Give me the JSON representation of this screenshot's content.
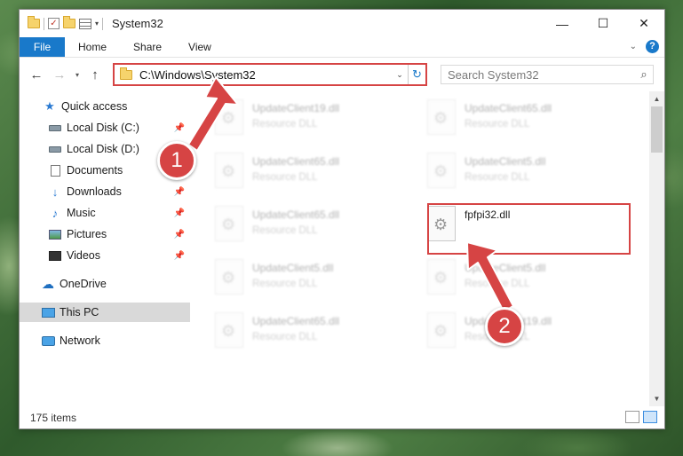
{
  "window": {
    "title": "System32",
    "controls": {
      "minimize": "—",
      "maximize": "☐",
      "close": "✕"
    }
  },
  "ribbon": {
    "tabs": [
      "File",
      "Home",
      "Share",
      "View"
    ]
  },
  "navigation": {
    "back": "←",
    "forward": "→",
    "recent": "▾",
    "up": "↑",
    "address": "C:\\Windows\\System32",
    "search_placeholder": "Search System32"
  },
  "sidebar": {
    "items": [
      {
        "label": "Quick access",
        "icon": "quick-access-star-icon"
      },
      {
        "label": "Local Disk (C:)",
        "icon": "drive-icon",
        "pinned": true
      },
      {
        "label": "Local Disk (D:)",
        "icon": "drive-icon",
        "pinned": false
      },
      {
        "label": "Documents",
        "icon": "documents-icon",
        "pinned": true
      },
      {
        "label": "Downloads",
        "icon": "downloads-icon",
        "pinned": true
      },
      {
        "label": "Music",
        "icon": "music-icon",
        "pinned": true
      },
      {
        "label": "Pictures",
        "icon": "pictures-icon",
        "pinned": true
      },
      {
        "label": "Videos",
        "icon": "videos-icon",
        "pinned": true
      },
      {
        "label": "OneDrive",
        "icon": "onedrive-icon"
      },
      {
        "label": "This PC",
        "icon": "this-pc-icon",
        "selected": true
      },
      {
        "label": "Network",
        "icon": "network-icon"
      }
    ]
  },
  "files": [
    {
      "name": "UpdateClient19.dll",
      "type": "Resource DLL"
    },
    {
      "name": "UpdateClient65.dll",
      "type": "Resource DLL"
    },
    {
      "name": "UpdateClient65.dll",
      "type": "Resource DLL"
    },
    {
      "name": "UpdateClient5.dll",
      "type": "Resource DLL"
    },
    {
      "name": "UpdateClient65.dll",
      "type": "Resource DLL"
    },
    {
      "name": "fpfpi32.dll",
      "type": ""
    },
    {
      "name": "UpdateClient5.dll",
      "type": "Resource DLL"
    },
    {
      "name": "UpdateClient5.dll",
      "type": "Resource DLL"
    },
    {
      "name": "UpdateClient65.dll",
      "type": "Resource DLL"
    },
    {
      "name": "UpdateClient19.dll",
      "type": "Resource DLL"
    }
  ],
  "status": {
    "item_count": "175 items"
  },
  "annotations": {
    "step1": "1",
    "step2": "2"
  },
  "colors": {
    "accent": "#1979ca",
    "annotation": "#d64444"
  }
}
